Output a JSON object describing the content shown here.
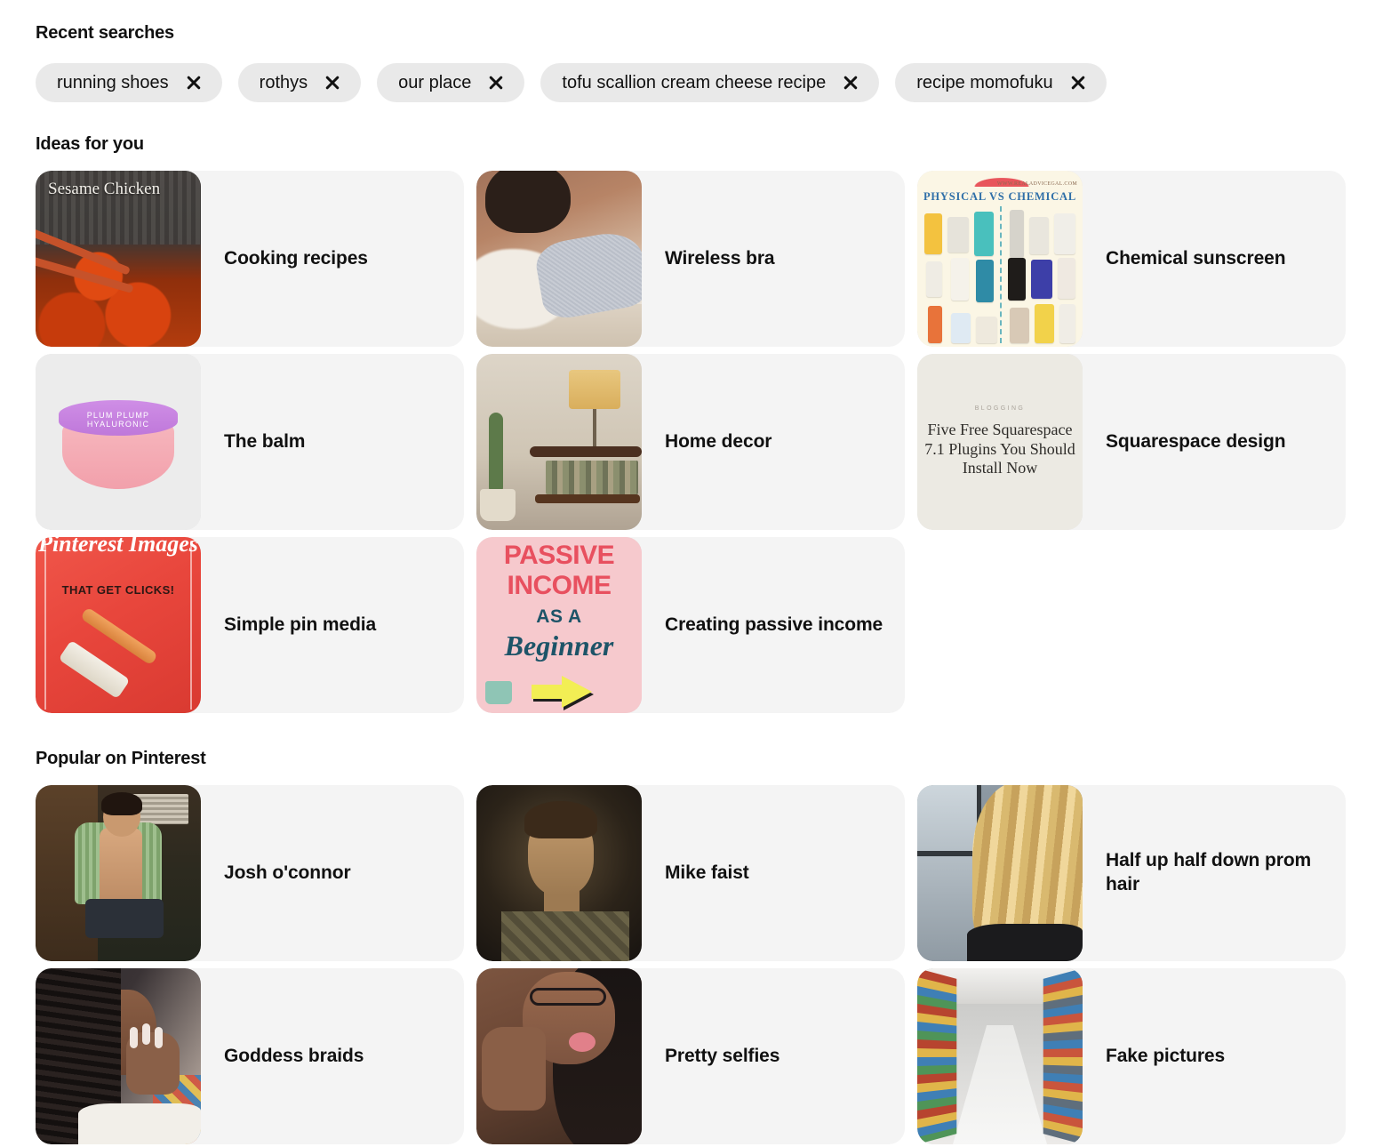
{
  "recent_searches": {
    "title": "Recent searches",
    "items": [
      {
        "label": "running shoes",
        "remove_icon": "close-icon"
      },
      {
        "label": "rothys",
        "remove_icon": "close-icon"
      },
      {
        "label": "our place",
        "remove_icon": "close-icon"
      },
      {
        "label": "tofu scallion cream cheese recipe",
        "remove_icon": "close-icon"
      },
      {
        "label": "recipe momofuku",
        "remove_icon": "close-icon"
      }
    ]
  },
  "ideas_for_you": {
    "title": "Ideas for you",
    "cards": [
      {
        "label": "Cooking recipes",
        "thumb": "sesame-chicken-photo",
        "thumb_text": "Sesame Chicken"
      },
      {
        "label": "Wireless bra",
        "thumb": "wireless-bra-photo"
      },
      {
        "label": "Chemical sunscreen",
        "thumb": "sunscreen-comparison-graphic",
        "thumb_text": "PHYSICAL  VS  CHEMICAL",
        "thumb_url": "WWW.REALADVICEGAL.COM"
      },
      {
        "label": "The balm",
        "thumb": "plum-plump-jar-photo",
        "thumb_text": "PLUM PLUMP HYALURONIC"
      },
      {
        "label": "Home decor",
        "thumb": "living-room-shelf-photo"
      },
      {
        "label": "Squarespace design",
        "thumb": "squarespace-blog-graphic",
        "thumb_kicker": "BLOGGING",
        "thumb_text": "Five Free Squarespace 7.1 Plugins You Should Install Now"
      },
      {
        "label": "Simple pin media",
        "thumb": "pinterest-images-graphic",
        "thumb_text": "Pinterest Images",
        "thumb_subtext": "THAT GET CLICKS!"
      },
      {
        "label": "Creating passive income",
        "thumb": "passive-income-graphic",
        "thumb_text_1": "PASSIVE",
        "thumb_text_2": "INCOME",
        "thumb_text_3": "AS A",
        "thumb_text_4": "Beginner"
      }
    ]
  },
  "popular_on_pinterest": {
    "title": "Popular on Pinterest",
    "cards": [
      {
        "label": "Josh o'connor",
        "thumb": "josh-oconnor-photo"
      },
      {
        "label": "Mike faist",
        "thumb": "mike-faist-photo"
      },
      {
        "label": "Half up half down prom hair",
        "thumb": "prom-hair-photo"
      },
      {
        "label": "Goddess braids",
        "thumb": "goddess-braids-photo"
      },
      {
        "label": "Pretty selfies",
        "thumb": "pretty-selfie-photo"
      },
      {
        "label": "Fake pictures",
        "thumb": "grocery-aisle-photo"
      }
    ]
  },
  "colors": {
    "page_background": "#ffffff",
    "chip_background": "#e9e9e9",
    "card_background": "#f4f4f4",
    "text_primary": "#111111"
  }
}
